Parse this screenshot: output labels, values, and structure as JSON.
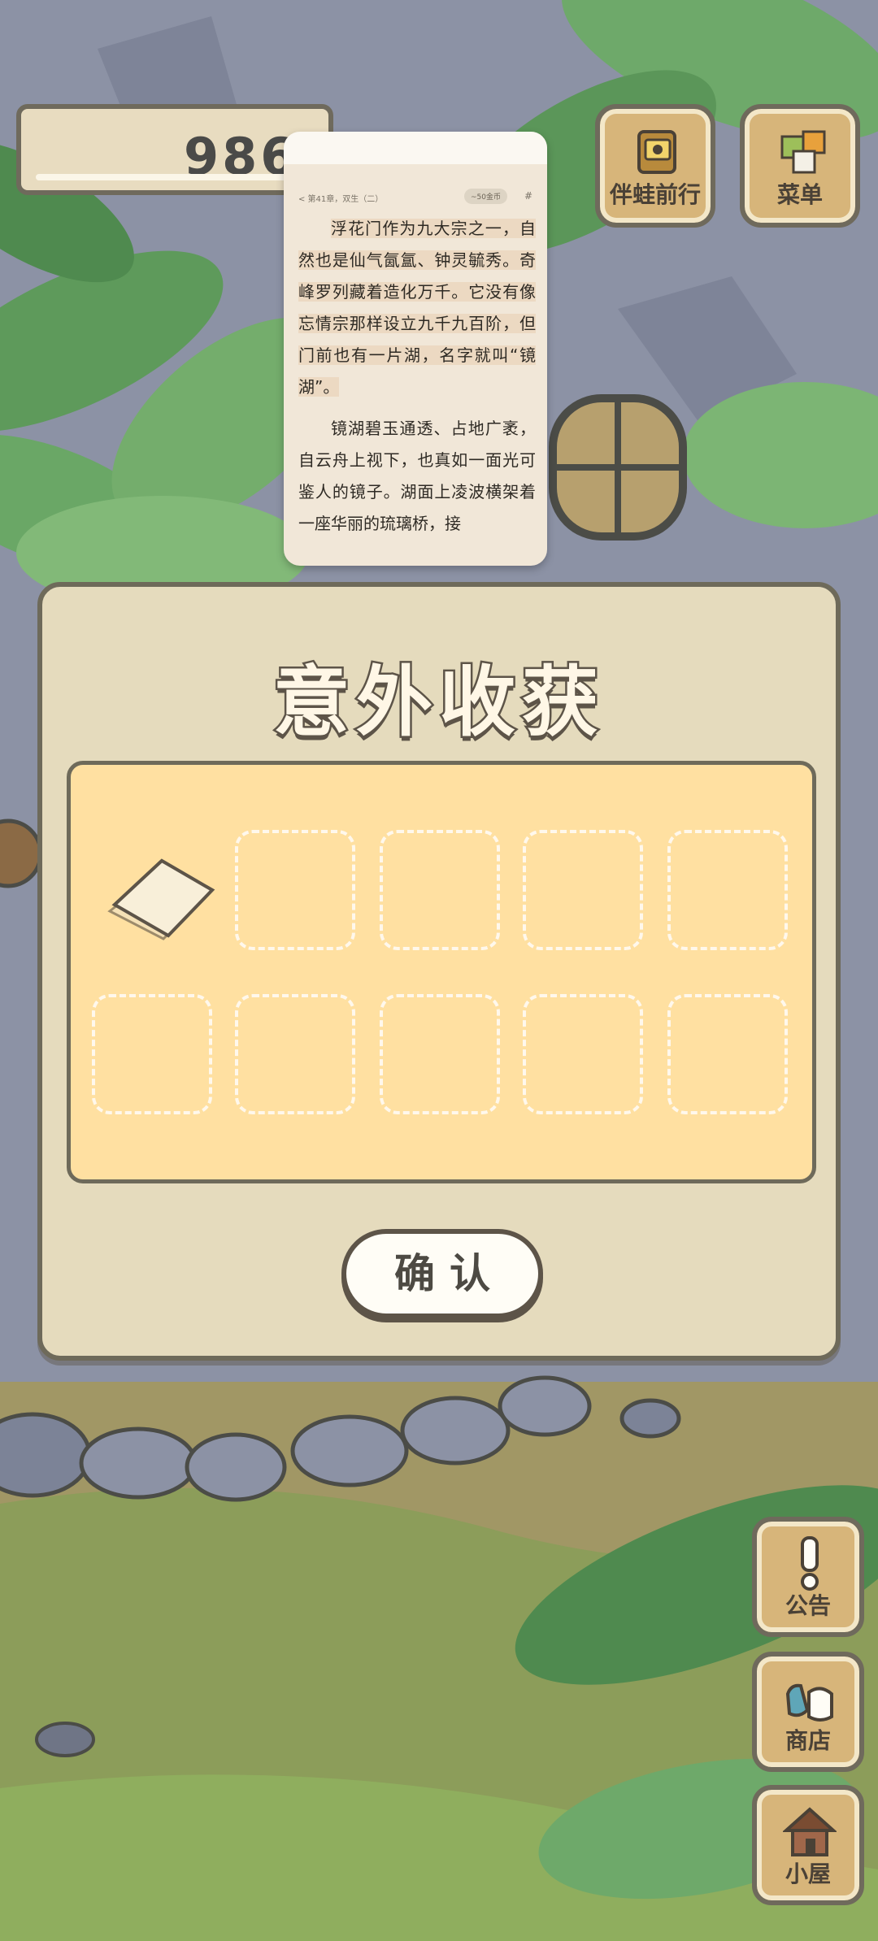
{
  "game": {
    "counter_value": "986",
    "top_buttons": [
      {
        "label": "伴蛙前行",
        "icon": "album-icon"
      },
      {
        "label": "菜单",
        "icon": "menu-icon"
      }
    ],
    "side_buttons": [
      {
        "label": "公告",
        "icon": "exclamation-icon"
      },
      {
        "label": "商店",
        "icon": "shop-bag-icon"
      },
      {
        "label": "小屋",
        "icon": "house-icon"
      }
    ]
  },
  "reader": {
    "chapter": "< 第41章，双生（二）",
    "pill": "~50金币",
    "hash": "#",
    "paragraph1": "浮花门作为九大宗之一，自然也是仙气氤氲、钟灵毓秀。奇峰罗列藏着造化万千。它没有像忘情宗那样设立九千九百阶，但门前也有一片湖，名字就叫“镜湖”。",
    "paragraph2": "镜湖碧玉通透、占地广袤，自云舟上视下，也真如一面光可鉴人的镜子。湖面上凌波横架着一座华丽的琉璃桥，接"
  },
  "dialog": {
    "title": "意外收获",
    "confirm_label": "确认",
    "items": [
      {
        "name": "paper",
        "icon": "paper-sheet-icon"
      }
    ],
    "empty_slots": 9
  },
  "colors": {
    "dialog_bg": "#e5dbbd",
    "panel_bg": "#ffe0a1",
    "border": "#6e6a5a",
    "button_wood": "#d7b57a"
  }
}
